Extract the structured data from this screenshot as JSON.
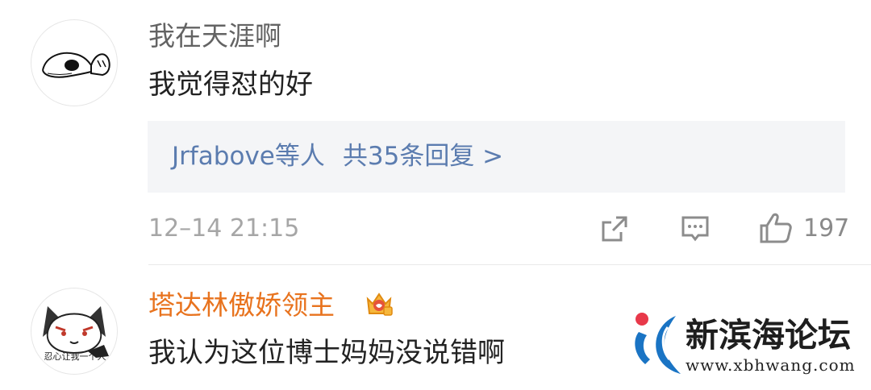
{
  "comments": [
    {
      "username": "我在天涯啊",
      "content": "我觉得怼的好",
      "replies": {
        "users": "Jrfabove等人",
        "summary": "共35条回复 >"
      },
      "time": "12–14 21:15",
      "likes": "197",
      "avatar_icon": "snoopy-sleeping-avatar",
      "name_color": "#636363"
    },
    {
      "username": "塔达林傲娇领主",
      "content": "我认为这位博士妈妈没说错啊",
      "avatar_icon": "cartoon-cat-avatar",
      "avatar_caption": "忍心让我一个人",
      "badge_icon": "crown-vip-badge",
      "name_color": "#e8731e"
    }
  ],
  "watermark": {
    "title": "新滨海论坛",
    "url": "www.xbhwang.com"
  },
  "colors": {
    "link": "#5b7caf",
    "reply_bg": "#f4f5f7",
    "muted": "#a6a6a6",
    "vip": "#e8731e"
  }
}
